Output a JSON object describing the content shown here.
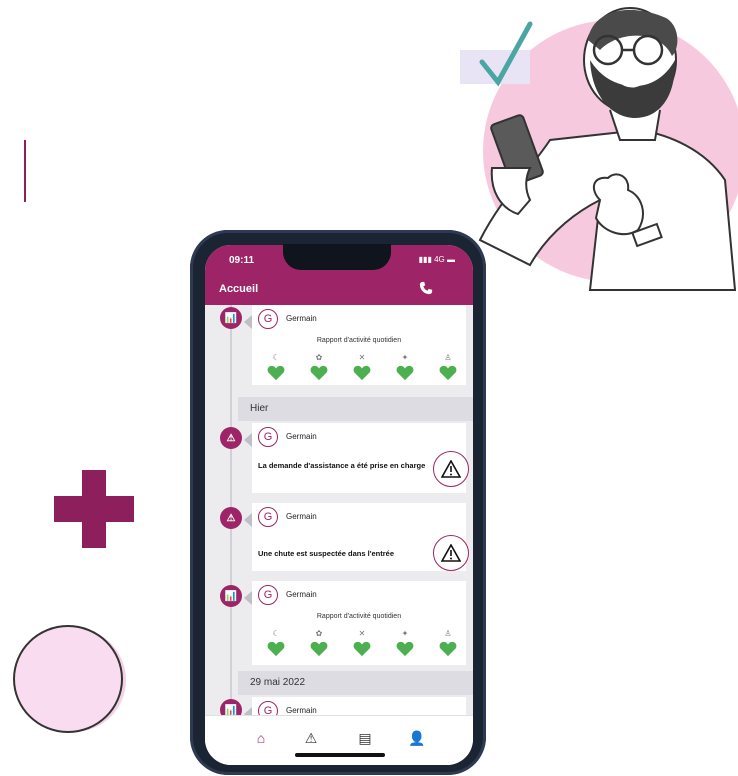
{
  "status": {
    "time": "09:11",
    "signal": "4G"
  },
  "header": {
    "title": "Accueil"
  },
  "feed": {
    "cards": [
      {
        "name": "Germain",
        "subtitle": "Rapport d'activité quotidien",
        "avatar_letter": "G"
      },
      {
        "name": "Germain",
        "message": "La demande d'assistance a été prise en charge",
        "avatar_letter": "G"
      },
      {
        "name": "Germain",
        "message": "Une chute est suspectée dans l'entrée",
        "avatar_letter": "G"
      },
      {
        "name": "Germain",
        "subtitle": "Rapport d'activité quotidien",
        "avatar_letter": "G"
      },
      {
        "name": "Germain",
        "avatar_letter": "G"
      }
    ],
    "date_headers": [
      "Hier",
      "29 mai 2022"
    ]
  },
  "nav": {
    "items": [
      "home-icon",
      "alert-icon",
      "chart-icon",
      "person-icon"
    ]
  },
  "colors": {
    "brand": "#9d2466",
    "heart_green": "#4caf50",
    "background": "#ffffff"
  }
}
